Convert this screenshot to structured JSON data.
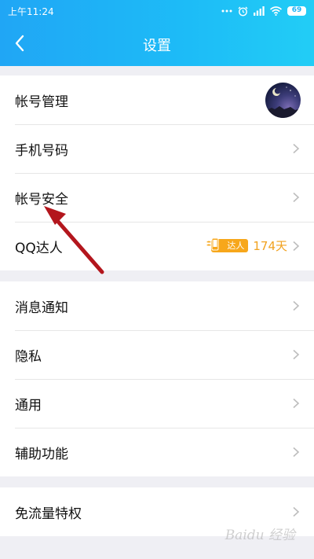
{
  "status_bar": {
    "time": "上午11:24",
    "battery": "69",
    "icons": [
      "signal-icon",
      "alarm-icon",
      "wifi-icon",
      "battery-icon"
    ]
  },
  "header": {
    "title": "设置",
    "back_icon": "back-arrow-icon"
  },
  "groups": [
    {
      "items": [
        {
          "label": "帐号管理",
          "accessory": "avatar"
        },
        {
          "label": "手机号码",
          "accessory": "chevron"
        },
        {
          "label": "帐号安全",
          "accessory": "chevron"
        },
        {
          "label": "QQ达人",
          "accessory": "badge",
          "badge_text": "达人",
          "days": "174天"
        }
      ]
    },
    {
      "items": [
        {
          "label": "消息通知",
          "accessory": "chevron"
        },
        {
          "label": "隐私",
          "accessory": "chevron"
        },
        {
          "label": "通用",
          "accessory": "chevron"
        },
        {
          "label": "辅助功能",
          "accessory": "chevron"
        }
      ]
    },
    {
      "items": [
        {
          "label": "免流量特权",
          "accessory": "chevron"
        }
      ]
    }
  ],
  "colors": {
    "header_gradient": [
      "#20a6f5",
      "#22cdf6"
    ],
    "background": "#efeff4",
    "badge": "#f7a71b",
    "annotation_arrow": "#b3161d"
  },
  "watermark": {
    "text": "Baidu 经验"
  }
}
